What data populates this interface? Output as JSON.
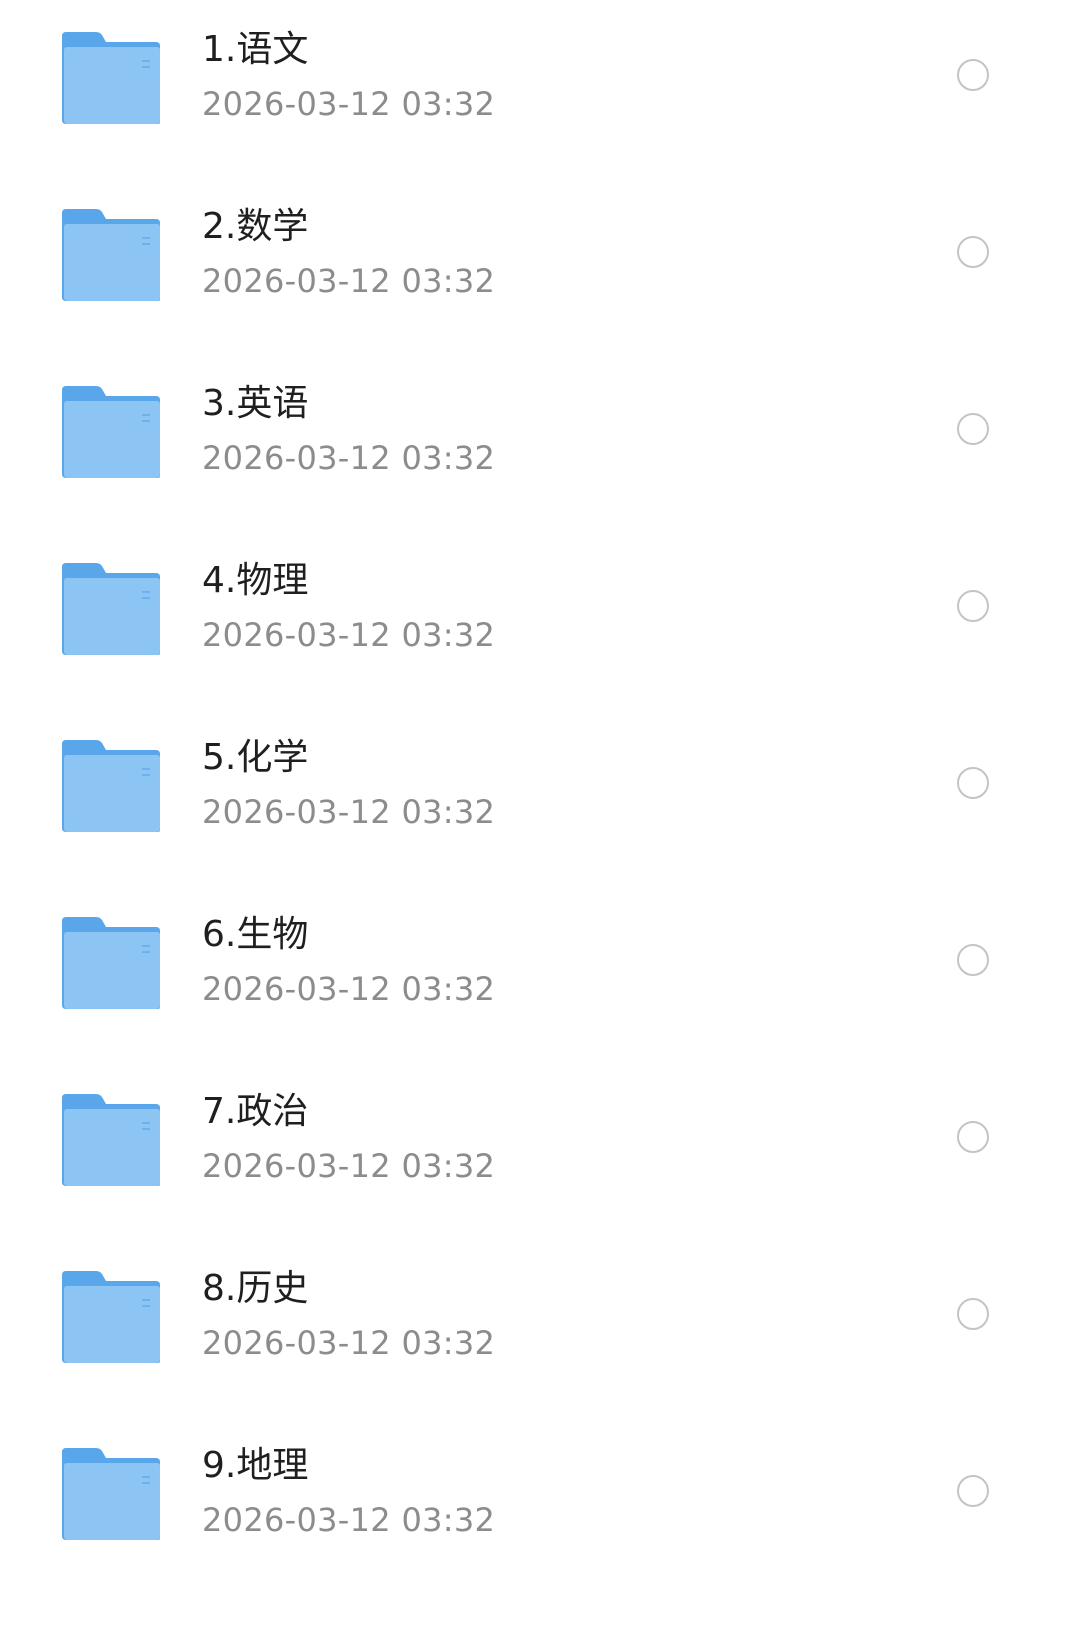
{
  "folders": [
    {
      "name": "1.语文",
      "date": "2026-03-12 03:32",
      "icon": "folder-icon",
      "checked": false
    },
    {
      "name": "2.数学",
      "date": "2026-03-12 03:32",
      "icon": "folder-icon",
      "checked": false
    },
    {
      "name": "3.英语",
      "date": "2026-03-12 03:32",
      "icon": "folder-icon",
      "checked": false
    },
    {
      "name": "4.物理",
      "date": "2026-03-12 03:32",
      "icon": "folder-icon",
      "checked": false
    },
    {
      "name": "5.化学",
      "date": "2026-03-12 03:32",
      "icon": "folder-icon",
      "checked": false
    },
    {
      "name": "6.生物",
      "date": "2026-03-12 03:32",
      "icon": "folder-icon",
      "checked": false
    },
    {
      "name": "7.政治",
      "date": "2026-03-12 03:32",
      "icon": "folder-icon",
      "checked": false
    },
    {
      "name": "8.历史",
      "date": "2026-03-12 03:32",
      "icon": "folder-icon",
      "checked": false
    },
    {
      "name": "9.地理",
      "date": "2026-03-12 03:32",
      "icon": "folder-icon",
      "checked": false
    }
  ],
  "colors": {
    "folder_front": "#8cc4f4",
    "folder_back": "#5aa6ea",
    "name_text": "#1f1f1f",
    "date_text": "#8c8c8c",
    "radio_border": "#c4c4c4"
  }
}
